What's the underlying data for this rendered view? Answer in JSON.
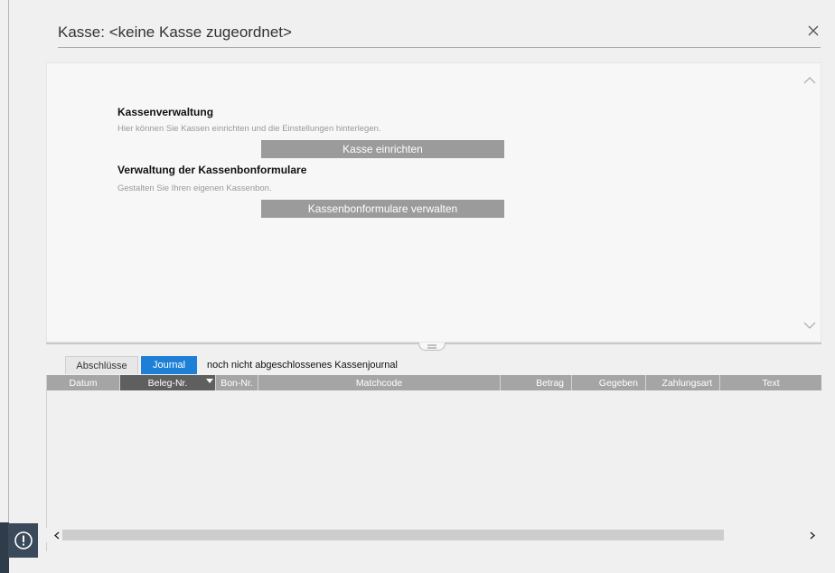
{
  "window": {
    "title": "Kasse: <keine Kasse zugeordnet>"
  },
  "icons": {
    "close": "close-icon",
    "info": "info-icon",
    "scroll_up": "chevron-up-icon",
    "scroll_down": "chevron-down-icon",
    "scroll_left": "chevron-left-icon",
    "scroll_right": "chevron-right-icon",
    "splitter": "drag-handle-icon"
  },
  "colors": {
    "accent": "#1e7fd6",
    "button": "#9b9b9b",
    "header": "#a5a5a5",
    "header_sorted": "#5f5f5f",
    "sidebar": "#2f3d4a"
  },
  "sections": [
    {
      "heading": "Kassenverwaltung",
      "description": "Hier können Sie Kassen einrichten und die Einstellungen hinterlegen.",
      "button_label": "Kasse einrichten"
    },
    {
      "heading": "Verwaltung der Kassenbonformulare",
      "description": "Gestalten Sie Ihren eigenen Kassenbon.",
      "button_label": "Kassenbonformulare verwalten"
    }
  ],
  "tabs": [
    {
      "label": "Abschlüsse",
      "active": false
    },
    {
      "label": "Journal",
      "active": true
    }
  ],
  "journal_status": "noch nicht abgeschlossenes Kassenjournal",
  "table": {
    "sorted_column": "Beleg-Nr.",
    "columns": [
      {
        "label": "Datum"
      },
      {
        "label": "Beleg-Nr."
      },
      {
        "label": "Bon-Nr."
      },
      {
        "label": "Matchcode"
      },
      {
        "label": "Betrag"
      },
      {
        "label": "Gegeben"
      },
      {
        "label": "Zahlungsart"
      },
      {
        "label": "Text"
      }
    ],
    "rows": []
  }
}
